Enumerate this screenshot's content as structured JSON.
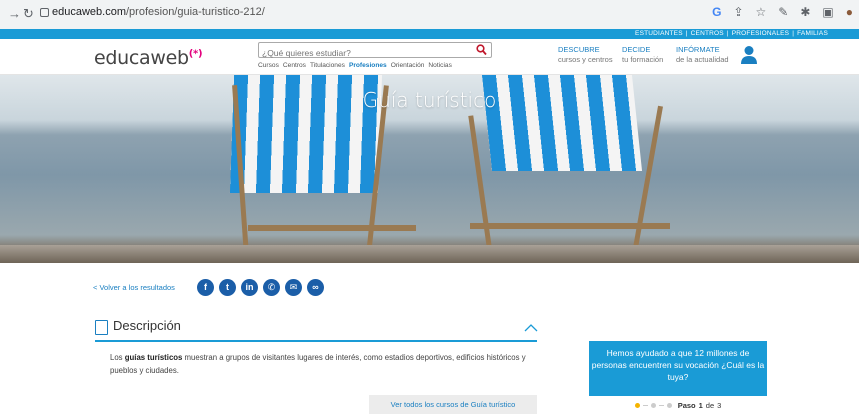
{
  "browser": {
    "url_host": "educaweb.com",
    "url_path": "/profesion/guia-turistico-212/",
    "icons": [
      "back-arrow-icon",
      "reload-icon",
      "google-icon",
      "share-icon",
      "star-icon",
      "extension-icon",
      "puzzle-icon",
      "tab-icon",
      "avatar-icon"
    ]
  },
  "top_links": [
    "ESTUDIANTES",
    "CENTROS",
    "PROFESIONALES",
    "FAMILIAS"
  ],
  "header": {
    "logo": "educaweb",
    "logo_mark": "(*)",
    "search_placeholder": "¿Qué quieres estudiar?",
    "subnav": [
      "Cursos",
      "Centros",
      "Titulaciones",
      "Profesiones",
      "Orientación",
      "Noticias"
    ],
    "subnav_active": "Profesiones",
    "blocks": [
      {
        "title": "DESCUBRE",
        "sub": "cursos y centros"
      },
      {
        "title": "DECIDE",
        "sub": "tu formación"
      },
      {
        "title": "INFÓRMATE",
        "sub": "de la actualidad"
      }
    ]
  },
  "hero": {
    "title": "Guía turístico"
  },
  "content": {
    "back_link": "< Volver a los resultados",
    "share_icons": [
      "facebook-icon",
      "twitter-icon",
      "linkedin-icon",
      "whatsapp-icon",
      "email-icon",
      "link-icon"
    ],
    "section_title": "Descripción",
    "desc_pre": "Los ",
    "desc_bold": "guías turísticos",
    "desc_post": " muestran a grupos de visitantes lugares de interés, como estadios deportivos, edificios históricos y pueblos y ciudades.",
    "courses_button": "Ver todos los cursos de Guía turístico"
  },
  "promo": {
    "text": "Hemos ayudado a que 12 millones de personas encuentren su vocación ¿Cuál es la tuya?",
    "step_label": "Paso",
    "step_current": "1",
    "step_sep": "de",
    "step_total": "3"
  },
  "colors": {
    "brand_blue": "#1a9bd6",
    "link_blue": "#1a7fc1",
    "accent_pink": "#e3007d",
    "share_blue": "#1b5ea8"
  }
}
